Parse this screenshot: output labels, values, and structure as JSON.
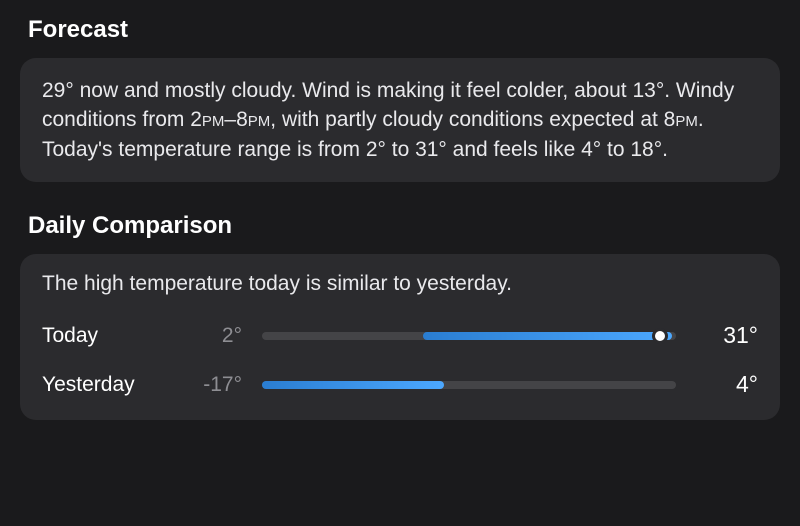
{
  "forecast": {
    "title": "Forecast",
    "text_parts": {
      "p1": "29° now and mostly cloudy. Wind is making it feel colder, about 13°. Windy conditions from 2",
      "pm1": "PM",
      "dash": "–8",
      "pm2": "PM",
      "p2": ", with partly cloudy conditions expected at 8",
      "pm3": "PM",
      "p3": ". Today's temperature range is from 2° to 31° and feels like 4° to 18°."
    }
  },
  "comparison": {
    "title": "Daily Comparison",
    "summary": "The high temperature today is similar to yesterday.",
    "rows": {
      "today": {
        "label": "Today",
        "low": "2°",
        "high": "31°"
      },
      "yesterday": {
        "label": "Yesterday",
        "low": "-17°",
        "high": "4°"
      }
    }
  }
}
